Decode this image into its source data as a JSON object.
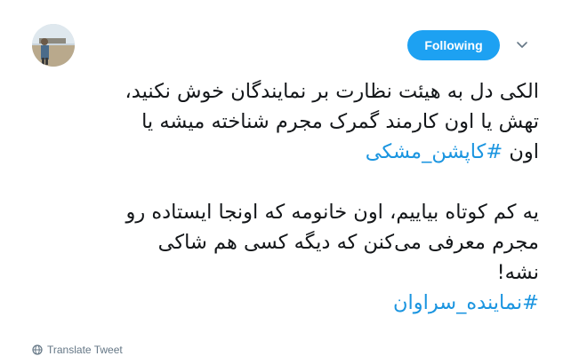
{
  "header": {
    "follow_button_label": "Following",
    "caret_icon": "chevron-down-icon",
    "avatar_icon": "avatar"
  },
  "tweet": {
    "paragraph1_lines": [
      "الکی دل به هیئت نظارت بر نمایندگان خوش نکنید،",
      "تهش یا اون کارمند گمرک مجرم شناخته میشه یا",
      "اون"
    ],
    "hashtag1": "#کاپشن_مشکی",
    "paragraph2_lines": [
      "یه کم کوتاه بیاییم، اون خانومه که اونجا ایستاده رو",
      "مجرم معرفی می‌کنن که دیگه کسی هم شاکی",
      "نشه!"
    ],
    "hashtag2": "#نماینده_سراوان"
  },
  "footer": {
    "translate_label": "Translate Tweet",
    "translate_icon": "globe-icon"
  },
  "colors": {
    "accent": "#1da1f2",
    "hashtag": "#1b95e0",
    "text": "#14171a",
    "muted": "#657786"
  }
}
